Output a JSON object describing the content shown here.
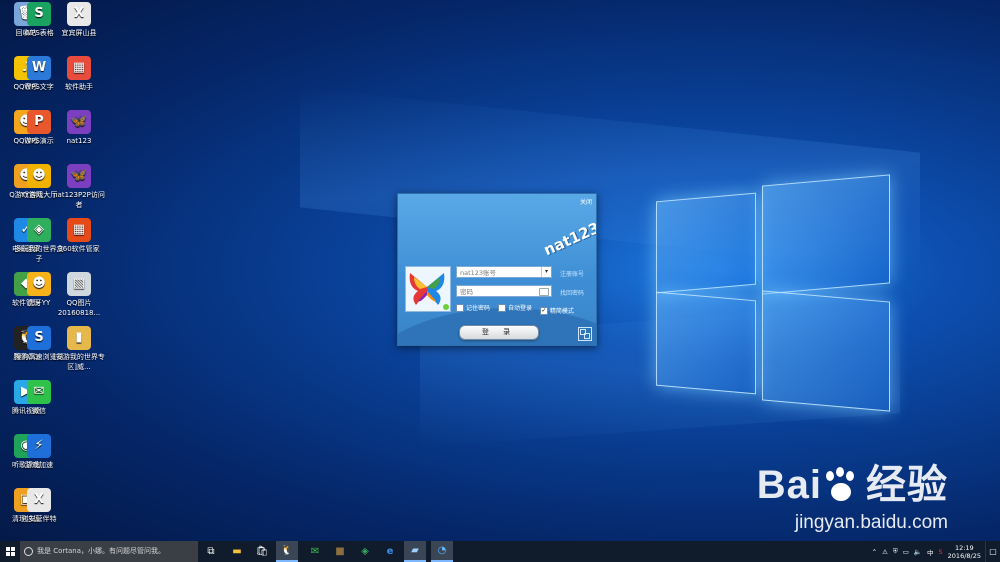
{
  "desktop": {
    "icons": [
      {
        "label": "回收站",
        "glyph": "🗑",
        "color": "#7aa6d9"
      },
      {
        "label": "WPS表格",
        "glyph": "S",
        "color": "#1aa260"
      },
      {
        "label": "宜宾屏山县",
        "glyph": "X",
        "color": "#e8e8e8"
      },
      {
        "label": "QQ音乐",
        "glyph": "♪",
        "color": "#f5c400"
      },
      {
        "label": "WPS文字",
        "glyph": "W",
        "color": "#2b79d8"
      },
      {
        "label": "软件助手",
        "glyph": "▦",
        "color": "#e74c3c"
      },
      {
        "label": "QQ游戏",
        "glyph": "☻",
        "color": "#f4a61d"
      },
      {
        "label": "WPS演示",
        "glyph": "P",
        "color": "#e8582c"
      },
      {
        "label": "nat123",
        "glyph": "🦋",
        "color": "#7b3fbf"
      },
      {
        "label": "Q游戏官网",
        "glyph": "☻",
        "color": "#f0a020"
      },
      {
        "label": "YY游戏大厅",
        "glyph": "☻",
        "color": "#f2b200"
      },
      {
        "label": "nat123P2P访问者",
        "glyph": "🦋",
        "color": "#7b3fbf"
      },
      {
        "label": "电脑管家",
        "glyph": "✓",
        "color": "#1e88e5"
      },
      {
        "label": "多玩我的世界盒子",
        "glyph": "◈",
        "color": "#2fae5e"
      },
      {
        "label": "360软件管家",
        "glyph": "▦",
        "color": "#e64a19"
      },
      {
        "label": "软件管理",
        "glyph": "◆",
        "color": "#43a047"
      },
      {
        "label": "虎牙YY",
        "glyph": "☻",
        "color": "#f5b21a"
      },
      {
        "label": "QQ图片20160818...",
        "glyph": "▧",
        "color": "#cfd8dc"
      },
      {
        "label": "腾讯QQ",
        "glyph": "🐧",
        "color": "#222"
      },
      {
        "label": "搜狗高速浏览器",
        "glyph": "S",
        "color": "#1e6fd9"
      },
      {
        "label": "[安游我的世界专区]威...",
        "glyph": "▮",
        "color": "#e6b84c"
      },
      {
        "label": "腾讯视频",
        "glyph": "▶",
        "color": "#2aa7e6"
      },
      {
        "label": "微信",
        "glyph": "✉",
        "color": "#2fc24b"
      },
      {
        "label": "听歌识曲",
        "glyph": "◉",
        "color": "#1fa35a"
      },
      {
        "label": "游戏加速",
        "glyph": "⚡",
        "color": "#1e6fd9"
      },
      {
        "label": "清理垃圾",
        "glyph": "▣",
        "color": "#f0a020"
      },
      {
        "label": "江安营伴特",
        "glyph": "X",
        "color": "#e8e8e8"
      }
    ]
  },
  "dialog": {
    "close_label": "关闭",
    "brand": "nat123",
    "username_placeholder": "nat123账号",
    "password_placeholder": "密码",
    "register_link": "注册账号",
    "forgot_link": "找回密码",
    "remember_label": "记住密码",
    "autologin_label": "自动登录",
    "compact_label": "精简模式",
    "login_button": "登 录"
  },
  "watermark": {
    "brand_left": "Bai",
    "brand_right": "经验",
    "url": "jingyan.baidu.com"
  },
  "taskbar": {
    "search_placeholder": "我是 Cortana，小娜。有问题尽管问我。",
    "time": "12:19",
    "date": "2016/8/25",
    "ime": "中"
  }
}
